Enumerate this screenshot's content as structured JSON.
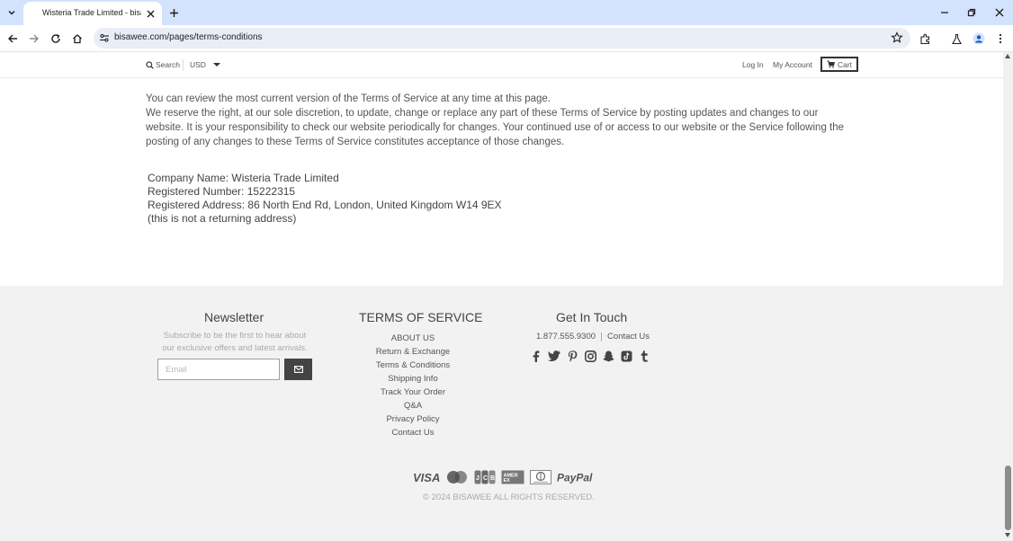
{
  "browser": {
    "tab_title": "Wisteria Trade Limited - bisawe",
    "url": "bisawee.com/pages/terms-conditions"
  },
  "header": {
    "search_label": "Search",
    "currency": "USD",
    "login": "Log In",
    "account": "My Account",
    "cart": "Cart"
  },
  "content": {
    "p1": "You can review the most current version of the Terms of Service at any time at this page.",
    "p2": "We reserve the right, at our sole discretion, to update, change or replace any part of these Terms of Service by posting updates and changes to our website. It is your responsibility to check our website periodically for changes. Your continued use of or access to our website or the Service following the posting of any changes to these Terms of Service constitutes acceptance of those changes.",
    "company_name": "Company Name: Wisteria Trade Limited",
    "registered_number": "Registered Number: 15222315",
    "registered_address": "Registered Address: 86 North End Rd, London, United Kingdom W14 9EX",
    "address_note": "(this is not a returning address)"
  },
  "footer": {
    "newsletter": {
      "title": "Newsletter",
      "text": "Subscribe to be the first to hear about our exclusive offers and latest arrivals.",
      "email_placeholder": "Email"
    },
    "terms": {
      "title": "TERMS OF SERVICE",
      "links": [
        "ABOUT US",
        "Return & Exchange",
        "Terms & Conditions",
        "Shipping Info",
        "Track Your Order",
        "Q&A",
        "Privacy Policy",
        "Contact Us"
      ]
    },
    "contact": {
      "title": "Get In Touch",
      "phone": "1.877.555.9300",
      "link": "Contact Us",
      "socials": [
        "facebook-icon",
        "twitter-icon",
        "pinterest-icon",
        "instagram-icon",
        "snapchat-icon",
        "tiktok-icon",
        "tumblr-icon"
      ]
    },
    "payments": [
      "VISA",
      "Mastercard",
      "JCB",
      "AMEX",
      "Diners Club",
      "PayPal"
    ],
    "copyright": "© 2024  BISAWEE ALL RIGHTS RESERVED."
  },
  "colors": {
    "chrome_tab_strip": "#d3e3fd",
    "footer_bg": "#f2f2f2",
    "button_dark": "#444444"
  }
}
